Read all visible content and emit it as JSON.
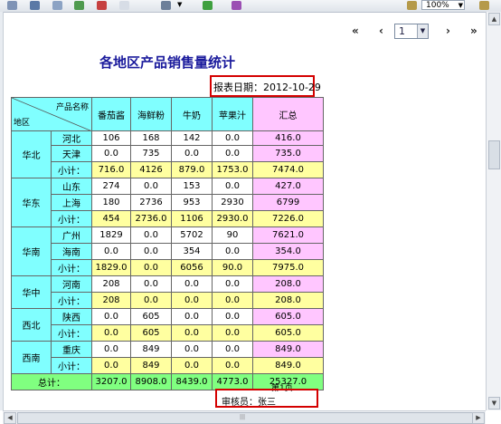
{
  "toolbar": {
    "zoom_value": "100%",
    "icons": [
      "print-icon",
      "save-icon",
      "export-icon",
      "excel-icon",
      "pdf-icon",
      "word-icon",
      "settings-icon",
      "refresh-icon",
      "close-icon"
    ]
  },
  "pager": {
    "first": "«",
    "prev": "‹",
    "page": "1",
    "next": "›",
    "last": "»"
  },
  "report": {
    "title": "各地区产品销售量统计",
    "date_label": "报表日期：",
    "date_value": "2012-10-29",
    "corner_top": "产品名称",
    "corner_bottom": "地区",
    "columns": [
      "番茄酱",
      "海鲜粉",
      "牛奶",
      "苹果汁",
      "汇总"
    ],
    "groups": [
      {
        "region": "华北",
        "rows": [
          {
            "city": "河北",
            "v": [
              "106",
              "168",
              "142",
              "0.0",
              "416.0"
            ]
          },
          {
            "city": "天津",
            "v": [
              "0.0",
              "735",
              "0.0",
              "0.0",
              "735.0"
            ]
          }
        ],
        "subtotal": {
          "label": "小计：",
          "v": [
            "716.0",
            "4126",
            "879.0",
            "1753.0",
            "7474.0"
          ]
        }
      },
      {
        "region": "华东",
        "rows": [
          {
            "city": "山东",
            "v": [
              "274",
              "0.0",
              "153",
              "0.0",
              "427.0"
            ]
          },
          {
            "city": "上海",
            "v": [
              "180",
              "2736",
              "953",
              "2930",
              "6799"
            ]
          }
        ],
        "subtotal": {
          "label": "小计：",
          "v": [
            "454",
            "2736.0",
            "1106",
            "2930.0",
            "7226.0"
          ]
        }
      },
      {
        "region": "华南",
        "rows": [
          {
            "city": "广州",
            "v": [
              "1829",
              "0.0",
              "5702",
              "90",
              "7621.0"
            ]
          },
          {
            "city": "海南",
            "v": [
              "0.0",
              "0.0",
              "354",
              "0.0",
              "354.0"
            ]
          }
        ],
        "subtotal": {
          "label": "小计：",
          "v": [
            "1829.0",
            "0.0",
            "6056",
            "90.0",
            "7975.0"
          ]
        }
      },
      {
        "region": "华中",
        "rows": [
          {
            "city": "河南",
            "v": [
              "208",
              "0.0",
              "0.0",
              "0.0",
              "208.0"
            ]
          }
        ],
        "subtotal": {
          "label": "小计：",
          "v": [
            "208",
            "0.0",
            "0.0",
            "0.0",
            "208.0"
          ]
        }
      },
      {
        "region": "西北",
        "rows": [
          {
            "city": "陕西",
            "v": [
              "0.0",
              "605",
              "0.0",
              "0.0",
              "605.0"
            ]
          }
        ],
        "subtotal": {
          "label": "小计：",
          "v": [
            "0.0",
            "605",
            "0.0",
            "0.0",
            "605.0"
          ]
        }
      },
      {
        "region": "西南",
        "rows": [
          {
            "city": "重庆",
            "v": [
              "0.0",
              "849",
              "0.0",
              "0.0",
              "849.0"
            ]
          }
        ],
        "subtotal": {
          "label": "小计：",
          "v": [
            "0.0",
            "849",
            "0.0",
            "0.0",
            "849.0"
          ]
        }
      }
    ],
    "total": {
      "label": "总计：",
      "v": [
        "3207.0",
        "8908.0",
        "8439.0",
        "4773.0",
        "25327.0"
      ]
    },
    "page_number": "第1页",
    "reviewer": "审核员：张三"
  }
}
